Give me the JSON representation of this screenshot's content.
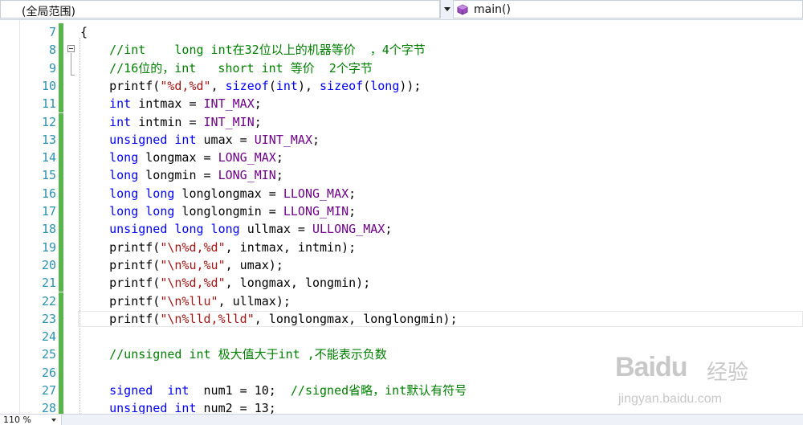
{
  "navigation": {
    "scope_label": "(全局范围)",
    "member_label": "main()",
    "member_icon": "cube-icon"
  },
  "status_bar": {
    "zoom": "110 %"
  },
  "watermark": {
    "logo": "Bai",
    "logo2": "du",
    "text": "经验",
    "url": "jingyan.baidu.com"
  },
  "editor": {
    "current_line": 23,
    "lines": [
      {
        "num": "7",
        "tokens": [
          {
            "t": "{",
            "c": ""
          }
        ]
      },
      {
        "num": "8",
        "tokens": [
          {
            "t": "    //int    long int在32位以上的机器等价  ，4个字节",
            "c": "cmt"
          }
        ]
      },
      {
        "num": "9",
        "tokens": [
          {
            "t": "    //16位的，int   short int 等价  2个字节",
            "c": "cmt"
          }
        ]
      },
      {
        "num": "10",
        "tokens": [
          {
            "t": "    printf(",
            "c": ""
          },
          {
            "t": "\"%d,%d\"",
            "c": "str"
          },
          {
            "t": ", ",
            "c": ""
          },
          {
            "t": "sizeof",
            "c": "kw"
          },
          {
            "t": "(",
            "c": ""
          },
          {
            "t": "int",
            "c": "kw"
          },
          {
            "t": "), ",
            "c": ""
          },
          {
            "t": "sizeof",
            "c": "kw"
          },
          {
            "t": "(",
            "c": ""
          },
          {
            "t": "long",
            "c": "kw"
          },
          {
            "t": "));",
            "c": ""
          }
        ]
      },
      {
        "num": "11",
        "tokens": [
          {
            "t": "    ",
            "c": ""
          },
          {
            "t": "int",
            "c": "kw"
          },
          {
            "t": " intmax = ",
            "c": ""
          },
          {
            "t": "INT_MAX",
            "c": "mac"
          },
          {
            "t": ";",
            "c": ""
          }
        ]
      },
      {
        "num": "12",
        "tokens": [
          {
            "t": "    ",
            "c": ""
          },
          {
            "t": "int",
            "c": "kw"
          },
          {
            "t": " intmin = ",
            "c": ""
          },
          {
            "t": "INT_MIN",
            "c": "mac"
          },
          {
            "t": ";",
            "c": ""
          }
        ]
      },
      {
        "num": "13",
        "tokens": [
          {
            "t": "    ",
            "c": ""
          },
          {
            "t": "unsigned int",
            "c": "kw"
          },
          {
            "t": " umax = ",
            "c": ""
          },
          {
            "t": "UINT_MAX",
            "c": "mac"
          },
          {
            "t": ";",
            "c": ""
          }
        ]
      },
      {
        "num": "14",
        "tokens": [
          {
            "t": "    ",
            "c": ""
          },
          {
            "t": "long",
            "c": "kw"
          },
          {
            "t": " longmax = ",
            "c": ""
          },
          {
            "t": "LONG_MAX",
            "c": "mac"
          },
          {
            "t": ";",
            "c": ""
          }
        ]
      },
      {
        "num": "15",
        "tokens": [
          {
            "t": "    ",
            "c": ""
          },
          {
            "t": "long",
            "c": "kw"
          },
          {
            "t": " longmin = ",
            "c": ""
          },
          {
            "t": "LONG_MIN",
            "c": "mac"
          },
          {
            "t": ";",
            "c": ""
          }
        ]
      },
      {
        "num": "16",
        "tokens": [
          {
            "t": "    ",
            "c": ""
          },
          {
            "t": "long long",
            "c": "kw"
          },
          {
            "t": " longlongmax = ",
            "c": ""
          },
          {
            "t": "LLONG_MAX",
            "c": "mac"
          },
          {
            "t": ";",
            "c": ""
          }
        ]
      },
      {
        "num": "17",
        "tokens": [
          {
            "t": "    ",
            "c": ""
          },
          {
            "t": "long long",
            "c": "kw"
          },
          {
            "t": " longlongmin = ",
            "c": ""
          },
          {
            "t": "LLONG_MIN",
            "c": "mac"
          },
          {
            "t": ";",
            "c": ""
          }
        ]
      },
      {
        "num": "18",
        "tokens": [
          {
            "t": "    ",
            "c": ""
          },
          {
            "t": "unsigned long long",
            "c": "kw"
          },
          {
            "t": " ullmax = ",
            "c": ""
          },
          {
            "t": "ULLONG_MAX",
            "c": "mac"
          },
          {
            "t": ";",
            "c": ""
          }
        ]
      },
      {
        "num": "19",
        "tokens": [
          {
            "t": "    printf(",
            "c": ""
          },
          {
            "t": "\"\\n%d,%d\"",
            "c": "str"
          },
          {
            "t": ", intmax, intmin);",
            "c": ""
          }
        ]
      },
      {
        "num": "20",
        "tokens": [
          {
            "t": "    printf(",
            "c": ""
          },
          {
            "t": "\"\\n%u,%u\"",
            "c": "str"
          },
          {
            "t": ", umax);",
            "c": ""
          }
        ]
      },
      {
        "num": "21",
        "tokens": [
          {
            "t": "    printf(",
            "c": ""
          },
          {
            "t": "\"\\n%d,%d\"",
            "c": "str"
          },
          {
            "t": ", longmax, longmin);",
            "c": ""
          }
        ]
      },
      {
        "num": "22",
        "tokens": [
          {
            "t": "    printf(",
            "c": ""
          },
          {
            "t": "\"\\n%llu\"",
            "c": "str"
          },
          {
            "t": ", ullmax);",
            "c": ""
          }
        ]
      },
      {
        "num": "23",
        "tokens": [
          {
            "t": "    printf(",
            "c": ""
          },
          {
            "t": "\"\\n%lld,%lld\"",
            "c": "str"
          },
          {
            "t": ", longlongmax, longlongmin);",
            "c": ""
          }
        ]
      },
      {
        "num": "24",
        "tokens": []
      },
      {
        "num": "25",
        "tokens": [
          {
            "t": "    //unsigned int 极大值大于int ,不能表示负数",
            "c": "cmt"
          }
        ]
      },
      {
        "num": "26",
        "tokens": []
      },
      {
        "num": "27",
        "tokens": [
          {
            "t": "    ",
            "c": ""
          },
          {
            "t": "signed",
            "c": "kw"
          },
          {
            "t": "  ",
            "c": ""
          },
          {
            "t": "int",
            "c": "kw"
          },
          {
            "t": "  num1 = 10;  ",
            "c": ""
          },
          {
            "t": "//signed省略，int默认有符号",
            "c": "cmt"
          }
        ]
      },
      {
        "num": "28",
        "tokens": [
          {
            "t": "    ",
            "c": ""
          },
          {
            "t": "unsigned",
            "c": "kw"
          },
          {
            "t": " ",
            "c": ""
          },
          {
            "t": "int",
            "c": "kw"
          },
          {
            "t": " num2 = 13;",
            "c": ""
          }
        ]
      }
    ]
  }
}
